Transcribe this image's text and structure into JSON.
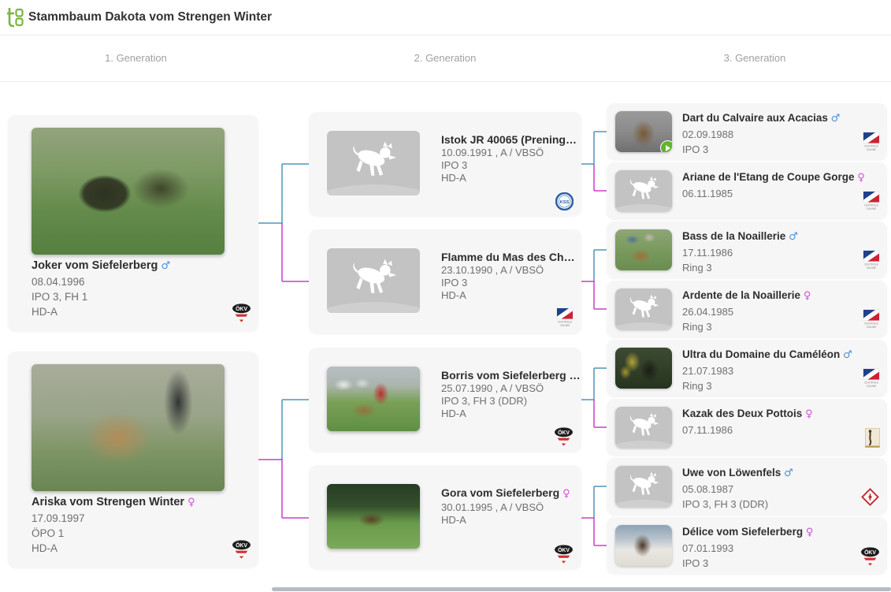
{
  "header": {
    "title": "Stammbaum Dakota vom Strengen Winter"
  },
  "generations": [
    {
      "label": "1. Generation"
    },
    {
      "label": "2. Generation"
    },
    {
      "label": "3. Generation"
    }
  ],
  "colors": {
    "logo_green": "#7cb342",
    "male_symbol": "#4a90d6",
    "female_symbol": "#d04fd8",
    "sire_line": "#4e96b8",
    "dam_line": "#c93fc9"
  },
  "badges": {
    "oekv_label": "ÖKV",
    "kss_label": "KSS",
    "scc_line1": "CENTRALE",
    "scc_line2": "CANINE"
  },
  "dogs": {
    "gen1": [
      {
        "name": "Joker vom Siefelerberg",
        "gender_symbol": "♂",
        "dob": "08.04.1996",
        "titles": "IPO 3, FH 1",
        "health": "HD-A",
        "badge": "ÖKV"
      },
      {
        "name": "Ariska vom Strengen Winter",
        "gender_symbol": "♀",
        "dob": "17.09.1997",
        "titles": "ÖPO 1",
        "health": "HD-A",
        "badge": "ÖKV"
      }
    ],
    "gen2": [
      {
        "name": "Istok JR 40065 (Prening…",
        "gender_symbol": "",
        "dob": "10.09.1991 , A / VBSÖ",
        "titles": "IPO 3",
        "health": "HD-A",
        "badge": "KSS"
      },
      {
        "name": "Flamme du Mas des Ch…",
        "gender_symbol": "",
        "dob": "23.10.1990 , A / VBSÖ",
        "titles": "IPO 3",
        "health": "HD-A",
        "badge": "Centrale Canine"
      },
      {
        "name": "Borris vom Siefelerberg …",
        "gender_symbol": "",
        "dob": "25.07.1990 , A / VBSÖ",
        "titles": "IPO 3, FH 3 (DDR)",
        "health": "HD-A",
        "badge": "ÖKV"
      },
      {
        "name": "Gora vom Siefelerberg",
        "gender_symbol": "♀",
        "dob": "30.01.1995 , A / VBSÖ",
        "health": "HD-A",
        "badge": "ÖKV"
      }
    ],
    "gen3": [
      {
        "name": "Dart du Calvaire aux Acacias",
        "gender_symbol": "♂",
        "dob": "02.09.1988",
        "titles": "IPO 3",
        "badge": "Centrale Canine",
        "has_video": true
      },
      {
        "name": "Ariane de l'Etang de Coupe Gorge",
        "gender_symbol": "♀",
        "dob": "06.11.1985",
        "badge": "Centrale Canine"
      },
      {
        "name": "Bass de la Noaillerie",
        "gender_symbol": "♂",
        "dob": "17.11.1986",
        "titles": "Ring 3",
        "badge": "Centrale Canine"
      },
      {
        "name": "Ardente de la Noaillerie",
        "gender_symbol": "♀",
        "dob": "26.04.1985",
        "titles": "Ring 3",
        "badge": "Centrale Canine"
      },
      {
        "name": "Ultra du Domaine du Caméléon",
        "gender_symbol": "♂",
        "dob": "21.07.1983",
        "titles": "Ring 3",
        "badge": "Centrale Canine"
      },
      {
        "name": "Kazak des Deux Pottois",
        "gender_symbol": "♀",
        "dob": "07.11.1986",
        "badge": "Société Royale Saint-Hubert"
      },
      {
        "name": "Uwe von Löwenfels",
        "gender_symbol": "♂",
        "dob": "05.08.1987",
        "titles": "IPO 3, FH 3 (DDR)",
        "badge": "VDH"
      },
      {
        "name": "Délice vom Siefelerberg",
        "gender_symbol": "♀",
        "dob": "07.01.1993",
        "titles": "IPO 3",
        "badge": "ÖKV"
      }
    ]
  }
}
